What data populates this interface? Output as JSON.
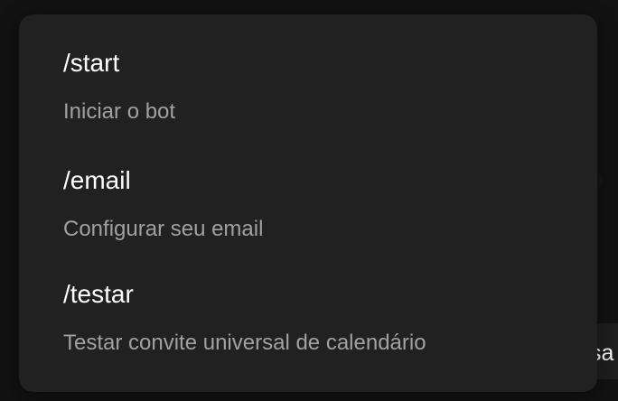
{
  "commands": [
    {
      "name": "/start",
      "description": "Iniciar o bot"
    },
    {
      "name": "/email",
      "description": "Configurar seu email"
    },
    {
      "name": "/testar",
      "description": "Testar convite universal de calendário"
    }
  ],
  "composer": {
    "visible_text": "sa"
  },
  "colors": {
    "menu_background": "#212121",
    "command_text": "#ffffff",
    "description_text": "#a1a1a1",
    "page_background": "#121212"
  }
}
